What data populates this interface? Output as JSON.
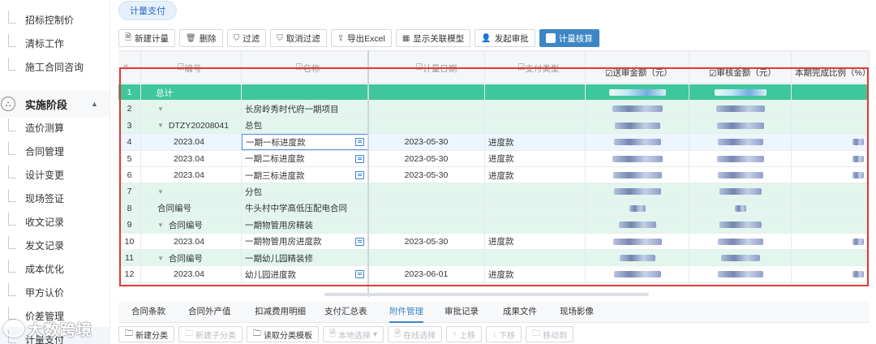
{
  "sidebar": {
    "items_top": [
      {
        "label": "招标控制价"
      },
      {
        "label": "清标工作"
      },
      {
        "label": "施工合同咨询"
      }
    ],
    "group": {
      "label": "实施阶段",
      "icon": "stage-icon"
    },
    "items": [
      {
        "label": "造价测算"
      },
      {
        "label": "合同管理"
      },
      {
        "label": "设计变更"
      },
      {
        "label": "现场签证"
      },
      {
        "label": "收文记录"
      },
      {
        "label": "发文记录"
      },
      {
        "label": "成本优化"
      },
      {
        "label": "甲方认价"
      },
      {
        "label": "价差管理"
      },
      {
        "label": "计量支付"
      }
    ]
  },
  "page_tab": {
    "label": "计量支付"
  },
  "toolbar": [
    {
      "label": "新建计量",
      "icon": "doc-icon"
    },
    {
      "label": "删除",
      "icon": "trash-icon"
    },
    {
      "label": "过滤",
      "icon": "filter-icon"
    },
    {
      "label": "取消过滤",
      "icon": "filter-off-icon"
    },
    {
      "label": "导出Excel",
      "icon": "export-icon"
    },
    {
      "label": "显示关联模型",
      "icon": "model-icon"
    },
    {
      "label": "发起审批",
      "icon": "person-icon"
    },
    {
      "label": "计量核算",
      "icon": "calc-icon",
      "primary": true
    }
  ],
  "grid": {
    "headers": {
      "seq": "#",
      "code": "编号",
      "name": "名称",
      "date": "计量日期",
      "type": "支付类型",
      "send_amount": "送审金额（元）",
      "audit_amount": "审核金额（元）",
      "ratio": "本期完成比例（%）"
    },
    "rows": [
      {
        "seq": "1",
        "code": "总计",
        "name": "",
        "date": "",
        "type": "",
        "style": "total"
      },
      {
        "seq": "2",
        "code": "",
        "name": "长房岭秀时代府一期项目",
        "date": "",
        "type": "",
        "style": "green"
      },
      {
        "seq": "3",
        "code": "DTZY20208041",
        "name": "总包",
        "date": "",
        "type": "",
        "style": "green"
      },
      {
        "seq": "4",
        "code": "2023.04",
        "name": "一期一标进度款",
        "date": "2023-05-30",
        "type": "进度款",
        "style": "sel"
      },
      {
        "seq": "5",
        "code": "2023.04",
        "name": "一期二标进度款",
        "date": "2023-05-30",
        "type": "进度款",
        "style": "white"
      },
      {
        "seq": "6",
        "code": "2023.04",
        "name": "一期三标进度款",
        "date": "2023-05-30",
        "type": "进度款",
        "style": "white"
      },
      {
        "seq": "7",
        "code": "",
        "name": "分包",
        "date": "",
        "type": "",
        "style": "green"
      },
      {
        "seq": "8",
        "code": "合同编号",
        "name": "牛头村中学高低压配电合同",
        "date": "",
        "type": "",
        "style": "green"
      },
      {
        "seq": "9",
        "code": "合同编号",
        "name": "一期物管用房精装",
        "date": "",
        "type": "",
        "style": "green"
      },
      {
        "seq": "10",
        "code": "2023.04",
        "name": "一期物管用房进度款",
        "date": "2023-05-30",
        "type": "进度款",
        "style": "white"
      },
      {
        "seq": "11",
        "code": "合同编号",
        "name": "一期幼儿园精装修",
        "date": "",
        "type": "",
        "style": "green"
      },
      {
        "seq": "12",
        "code": "2023.04",
        "name": "幼儿园进度款",
        "date": "2023-06-01",
        "type": "进度款",
        "style": "white"
      }
    ]
  },
  "bottom_tabs": [
    "合同条款",
    "合同外产值",
    "扣减费用明细",
    "支付汇总表",
    "附件管理",
    "审批记录",
    "成果文件",
    "现场影像"
  ],
  "bottom_active": "附件管理",
  "bottom_toolbar": [
    {
      "label": "新建分类",
      "disabled": false
    },
    {
      "label": "新建子分类",
      "disabled": true
    },
    {
      "label": "读取分类模板",
      "disabled": false
    },
    {
      "label": "本地选择",
      "disabled": true
    },
    {
      "label": "在线选择",
      "disabled": true
    },
    {
      "label": "上移",
      "disabled": true
    },
    {
      "label": "下移",
      "disabled": true
    },
    {
      "label": "移动到",
      "disabled": true
    }
  ],
  "watermark": {
    "text": "大数跨境"
  },
  "colors": {
    "accent": "#3d86c6",
    "total_row": "#3fc79c",
    "group_row": "#e2f6ee",
    "highlight": "#e53935"
  }
}
